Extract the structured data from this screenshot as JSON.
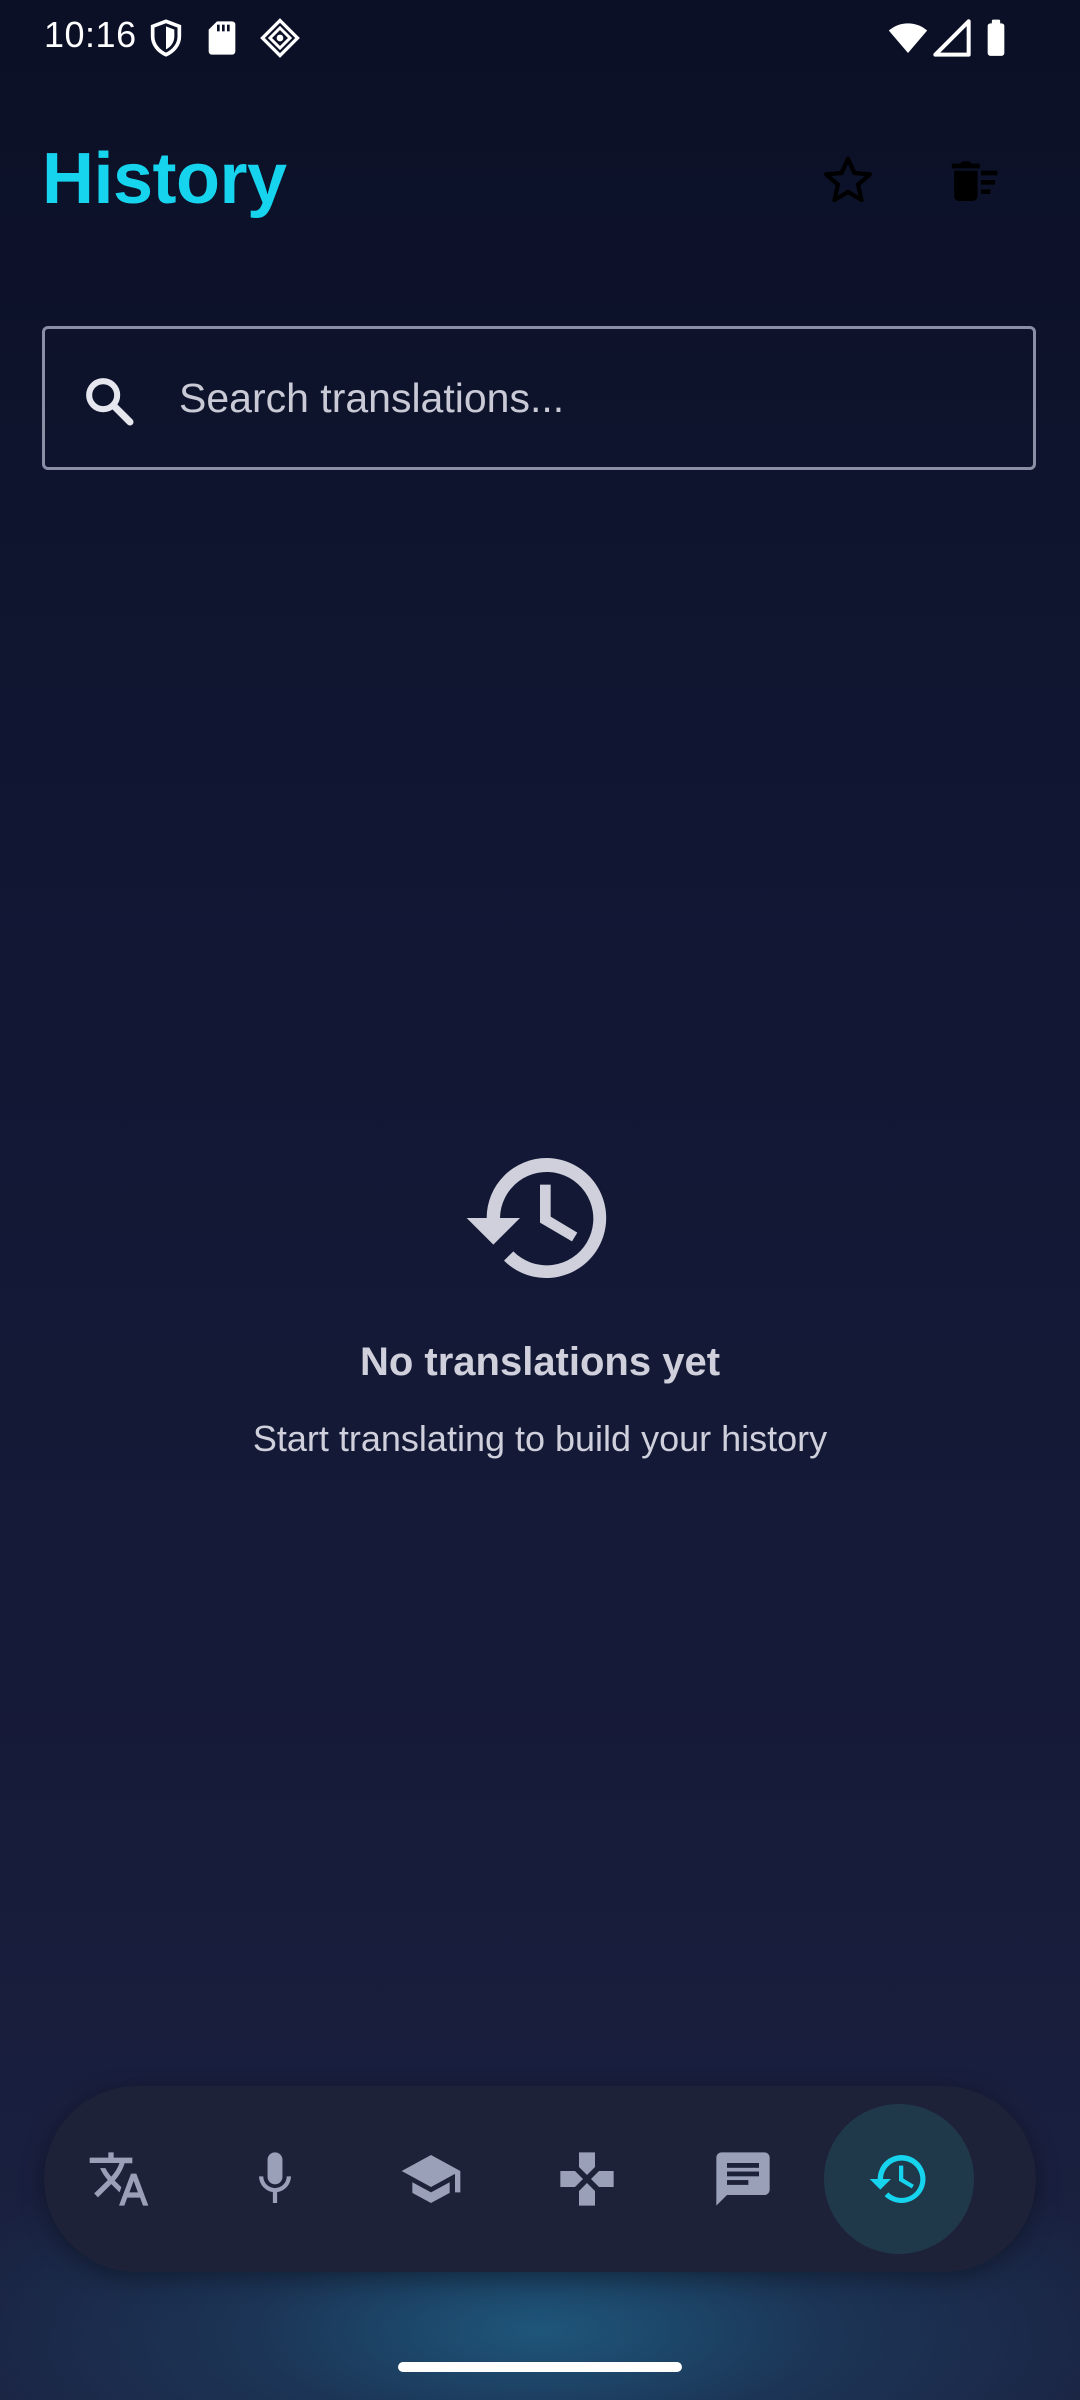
{
  "status_bar": {
    "time": "10:16",
    "left_icons": [
      "shield-icon",
      "sd-card-icon",
      "cast-diamond-icon"
    ],
    "right_icons": [
      "wifi-icon",
      "cell-signal-icon",
      "battery-icon"
    ]
  },
  "header": {
    "title": "History",
    "favorites_icon": "star-outline-icon",
    "clear_icon": "delete-sweep-icon"
  },
  "search": {
    "placeholder": "Search translations...",
    "value": "",
    "icon": "search-icon"
  },
  "empty_state": {
    "icon": "history-icon",
    "title": "No translations yet",
    "subtitle": "Start translating to build your history"
  },
  "bottom_nav": {
    "items": [
      {
        "icon": "translate-icon",
        "active": false
      },
      {
        "icon": "microphone-icon",
        "active": false
      },
      {
        "icon": "school-icon",
        "active": false
      },
      {
        "icon": "gamepad-icon",
        "active": false
      },
      {
        "icon": "chat-icon",
        "active": false
      },
      {
        "icon": "history-icon",
        "active": true
      }
    ]
  },
  "colors": {
    "accent": "#16d3ee",
    "background_top": "#0b1026",
    "background_bottom": "#1b2241",
    "nav_background": "#1d2238",
    "nav_icon": "#9aa0b8",
    "empty_text": "#cfd0dc"
  }
}
